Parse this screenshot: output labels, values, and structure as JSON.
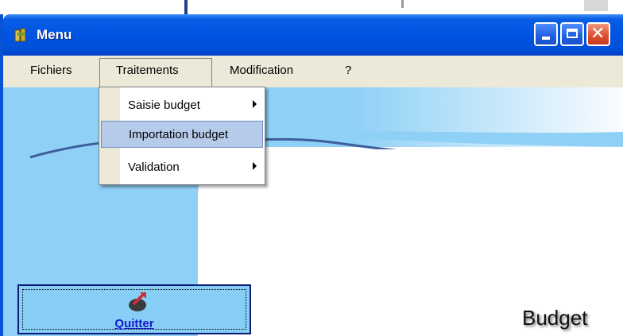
{
  "window": {
    "title": "Menu",
    "controls": {
      "minimize": "minimize",
      "maximize": "maximize",
      "close": "close"
    },
    "titlebar_color": "#0054e3"
  },
  "menubar": {
    "items": [
      {
        "label": "Fichiers"
      },
      {
        "label": "Traitements"
      },
      {
        "label": "Modification"
      },
      {
        "label": "?"
      }
    ]
  },
  "dropdown": {
    "items": [
      {
        "label": "Saisie budget",
        "submenu": true
      },
      {
        "label": "Importation budget",
        "highlighted": true
      },
      {
        "label": "Validation",
        "submenu": true
      }
    ],
    "highlight_color": "#b6cbea"
  },
  "quit_button": {
    "label": "Quitter",
    "icon": "exit-icon"
  },
  "background": {
    "text": "Budget",
    "accent": "#87cef6"
  }
}
